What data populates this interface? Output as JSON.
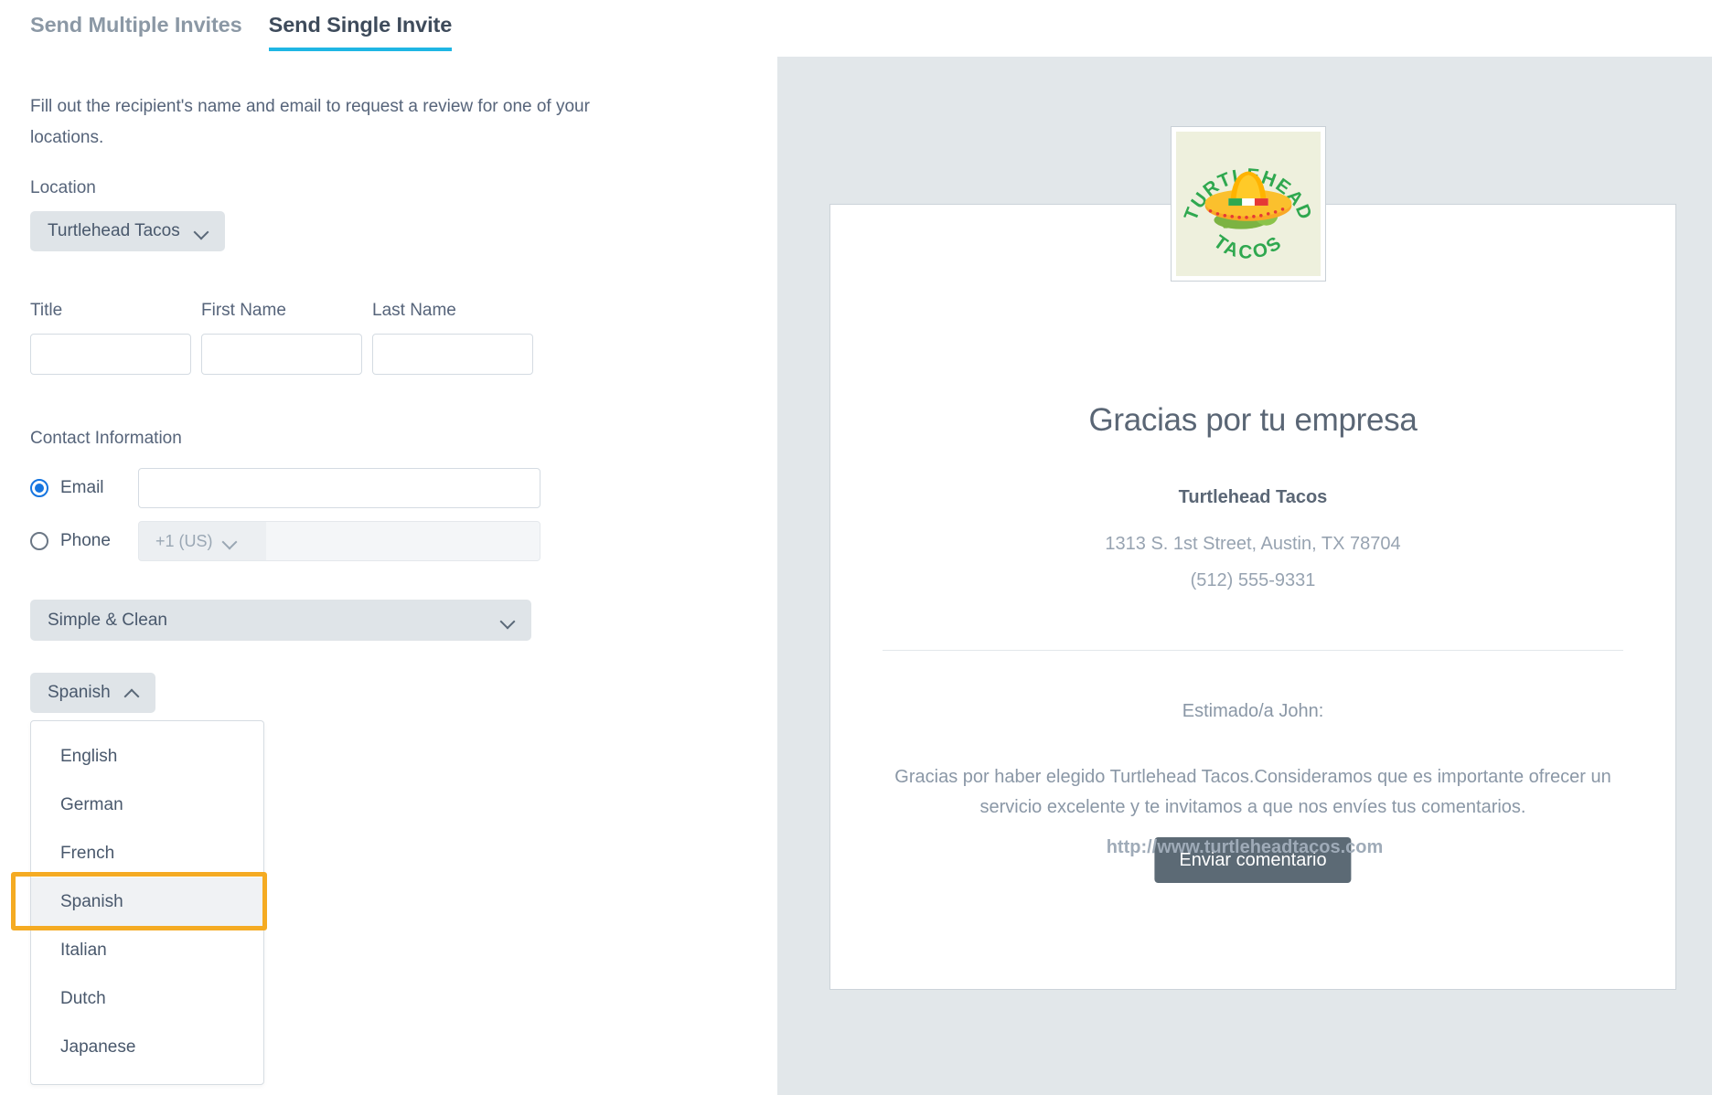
{
  "tabs": [
    {
      "label": "Send Multiple Invites",
      "active": false
    },
    {
      "label": "Send Single Invite",
      "active": true
    }
  ],
  "form": {
    "intro": "Fill out the recipient's name and email to request a review for one of your locations.",
    "location_label": "Location",
    "location_value": "Turtlehead Tacos",
    "title_label": "Title",
    "title_value": "",
    "first_name_label": "First Name",
    "first_name_value": "",
    "last_name_label": "Last Name",
    "last_name_value": "",
    "contact_label": "Contact Information",
    "email_label": "Email",
    "email_value": "",
    "phone_label": "Phone",
    "phone_country_code": "+1 (US)",
    "phone_value": "",
    "template_value": "Simple & Clean",
    "language_value": "Spanish",
    "language_options": [
      "English",
      "German",
      "French",
      "Spanish",
      "Italian",
      "Dutch",
      "Japanese"
    ],
    "language_selected": "Spanish"
  },
  "preview": {
    "logo_top_text": "TURTLEHEAD",
    "logo_bottom_text": "TACOS",
    "title": "Gracias por tu empresa",
    "business_name": "Turtlehead Tacos",
    "address": "1313 S. 1st Street, Austin, TX 78704",
    "phone": "(512) 555-9331",
    "greeting": "Estimado/a John:",
    "body": "Gracias por haber elegido Turtlehead Tacos.Consideramos que es importante ofrecer un servicio excelente y te invitamos a que nos envíes tus comentarios.",
    "cta_label": "Enviar comentario",
    "footer_url": "http://www.turtleheadtacos.com"
  },
  "colors": {
    "accent": "#1fb6e4",
    "focus_ring": "#f5ab22",
    "radio_checked": "#1675e0",
    "cta_bg": "#5c6a75",
    "preview_bg": "#e2e7ea",
    "logo_green": "#2fa84f",
    "logo_bg": "#eef0dd"
  }
}
